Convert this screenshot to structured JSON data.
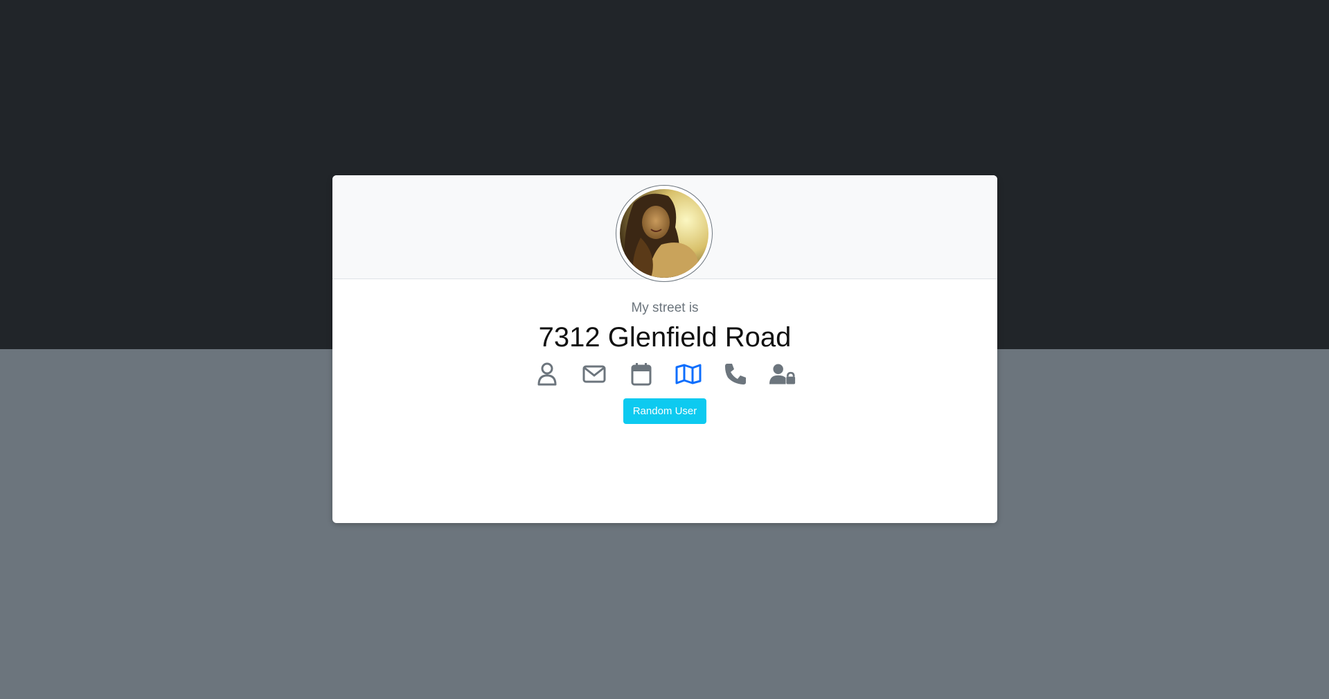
{
  "profile": {
    "label": "My street is",
    "value": "7312 Glenfield Road"
  },
  "icons": [
    {
      "name": "user-icon",
      "active": false
    },
    {
      "name": "envelope-icon",
      "active": false
    },
    {
      "name": "calendar-icon",
      "active": false
    },
    {
      "name": "map-icon",
      "active": true
    },
    {
      "name": "phone-icon",
      "active": false
    },
    {
      "name": "user-lock-icon",
      "active": false
    }
  ],
  "actions": {
    "random_user_label": "Random User"
  },
  "colors": {
    "top_background": "#212529",
    "bottom_background": "#6c757d",
    "icon_default": "#6c757d",
    "icon_active": "#0d6efd",
    "button": "#0dcaf0"
  }
}
